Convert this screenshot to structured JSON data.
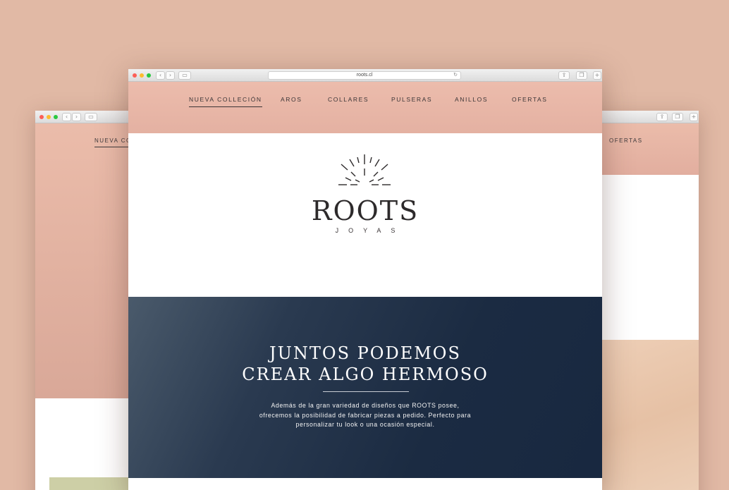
{
  "background": {
    "color": "#e1b9a5"
  },
  "browser": {
    "url": "roots.cl",
    "back_glyph": "‹",
    "forward_glyph": "›",
    "sidebar_glyph": "▭",
    "share_glyph": "⇪",
    "tabs_glyph": "❐",
    "newtab_glyph": "+",
    "reload_glyph": "↻"
  },
  "nav": {
    "items": [
      "NUEVA COLLECIÓN",
      "AROS",
      "COLLARES",
      "PULSERAS",
      "ANILLOS",
      "OFERTAS"
    ],
    "active_index": 0
  },
  "logo": {
    "brand": "ROOTS",
    "subtitle": "JOYAS",
    "icon": "sunrise-icon"
  },
  "banner": {
    "headline_line1": "JUNTOS PODEMOS",
    "headline_line2": "CREAR ALGO HERMOSO",
    "body_line1": "Además de la gran variedad de diseños que ROOTS posee,",
    "body_line2": "ofrecemos la posibilidad de fabricar piezas a pedido. Perfecto para",
    "body_line3": "personalizar tu look o una ocasión especial."
  },
  "colors": {
    "nav_bg": "#e6b3a4",
    "banner_bg": "#1b2b42",
    "text_dark": "#2d2a2b"
  }
}
